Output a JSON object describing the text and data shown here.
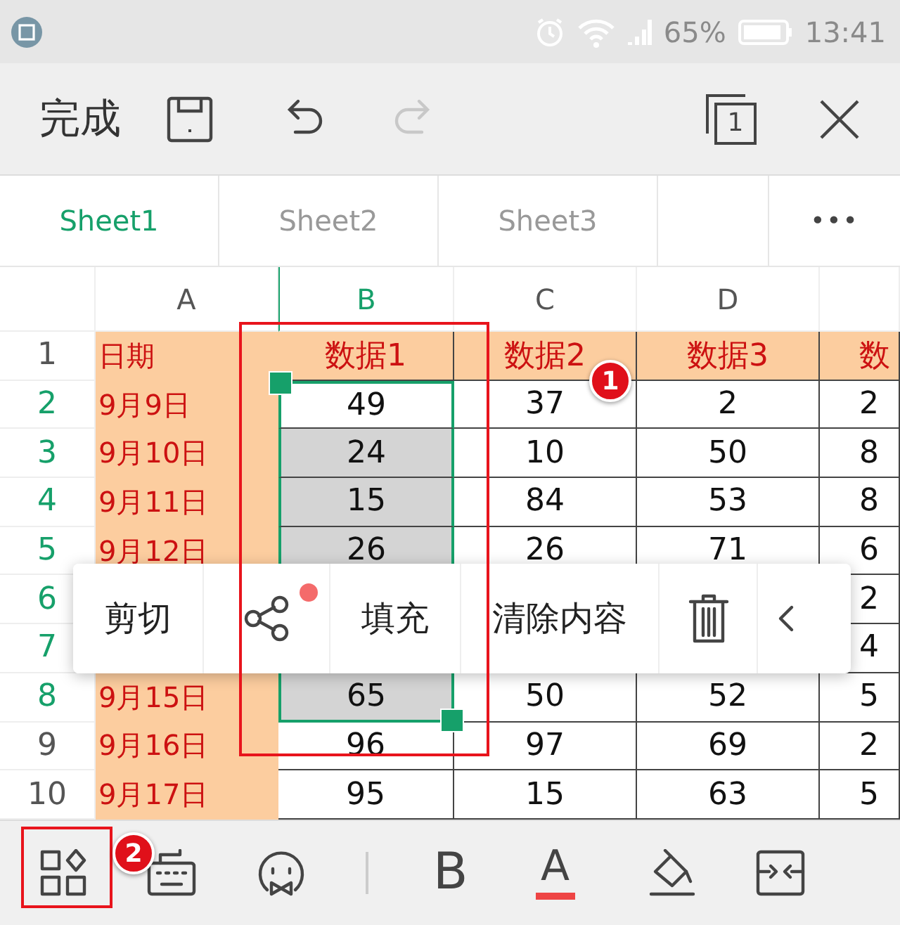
{
  "status_bar": {
    "battery": "65%",
    "time": "13:41"
  },
  "toolbar": {
    "items": [
      {
        "kind": "text",
        "label": "完成",
        "disabled": false
      },
      {
        "kind": "save",
        "disabled": false
      },
      {
        "kind": "undo",
        "disabled": false
      },
      {
        "kind": "redo",
        "disabled": true
      },
      {
        "kind": "windows",
        "label": "1",
        "disabled": false
      },
      {
        "kind": "close",
        "disabled": false
      }
    ]
  },
  "sheet_tabs": [
    {
      "label": "Sheet1",
      "selected": true
    },
    {
      "label": "Sheet2",
      "selected": false
    },
    {
      "label": "Sheet3",
      "selected": false
    }
  ],
  "more_button": "•••",
  "table": {
    "columns": [
      {
        "label": "A",
        "selected": false
      },
      {
        "label": "B",
        "selected": true
      },
      {
        "label": "C",
        "selected": false
      },
      {
        "label": "D",
        "selected": false
      },
      {
        "selected": false
      }
    ],
    "rows": [
      {
        "number": "1",
        "selected": false,
        "cells": [
          "日期",
          "数据1",
          "数据2",
          "数据3",
          "数"
        ]
      },
      {
        "number": "2",
        "selected": true,
        "cells": [
          "9月9日",
          "49",
          "37",
          "2",
          "2"
        ]
      },
      {
        "number": "3",
        "selected": true,
        "cells": [
          "9月10日",
          "24",
          "10",
          "50",
          "8"
        ]
      },
      {
        "number": "4",
        "selected": true,
        "cells": [
          "9月11日",
          "15",
          "84",
          "53",
          "8"
        ]
      },
      {
        "number": "5",
        "selected": true,
        "cells": [
          "9月12日",
          "26",
          "26",
          "71",
          "6"
        ]
      },
      {
        "number": "6",
        "selected": true,
        "cells": [
          null,
          null,
          null,
          null,
          "2"
        ]
      },
      {
        "number": "7",
        "selected": true,
        "cells": [
          null,
          null,
          null,
          null,
          "4"
        ]
      },
      {
        "number": "8",
        "selected": true,
        "cells": [
          "9月15日",
          "65",
          "50",
          "52",
          "5"
        ]
      },
      {
        "number": "9",
        "selected": false,
        "cells": [
          "9月16日",
          "96",
          "97",
          "69",
          "2"
        ]
      },
      {
        "number": "10",
        "selected": false,
        "cells": [
          "9月17日",
          "95",
          "15",
          "63",
          "5"
        ]
      }
    ]
  },
  "context_menu": {
    "items": [
      {
        "kind": "text",
        "label": "剪切"
      },
      {
        "kind": "share",
        "badge": true
      },
      {
        "kind": "text",
        "label": "填充"
      },
      {
        "kind": "text",
        "label": "清除内容"
      },
      {
        "kind": "trash"
      },
      {
        "kind": "chevron"
      }
    ]
  },
  "bottom_toolbar": {
    "items": [
      {
        "kind": "apps"
      },
      {
        "kind": "keyboard"
      },
      {
        "kind": "emoji"
      },
      {
        "kind": "divider"
      },
      {
        "kind": "bold",
        "label": "B"
      },
      {
        "kind": "font_color",
        "label": "A"
      },
      {
        "kind": "fill"
      },
      {
        "kind": "merge"
      }
    ]
  },
  "annotations": [
    {
      "kind": "box"
    },
    {
      "kind": "badge",
      "label": "1"
    },
    {
      "kind": "box"
    },
    {
      "kind": "badge",
      "label": "2"
    }
  ]
}
